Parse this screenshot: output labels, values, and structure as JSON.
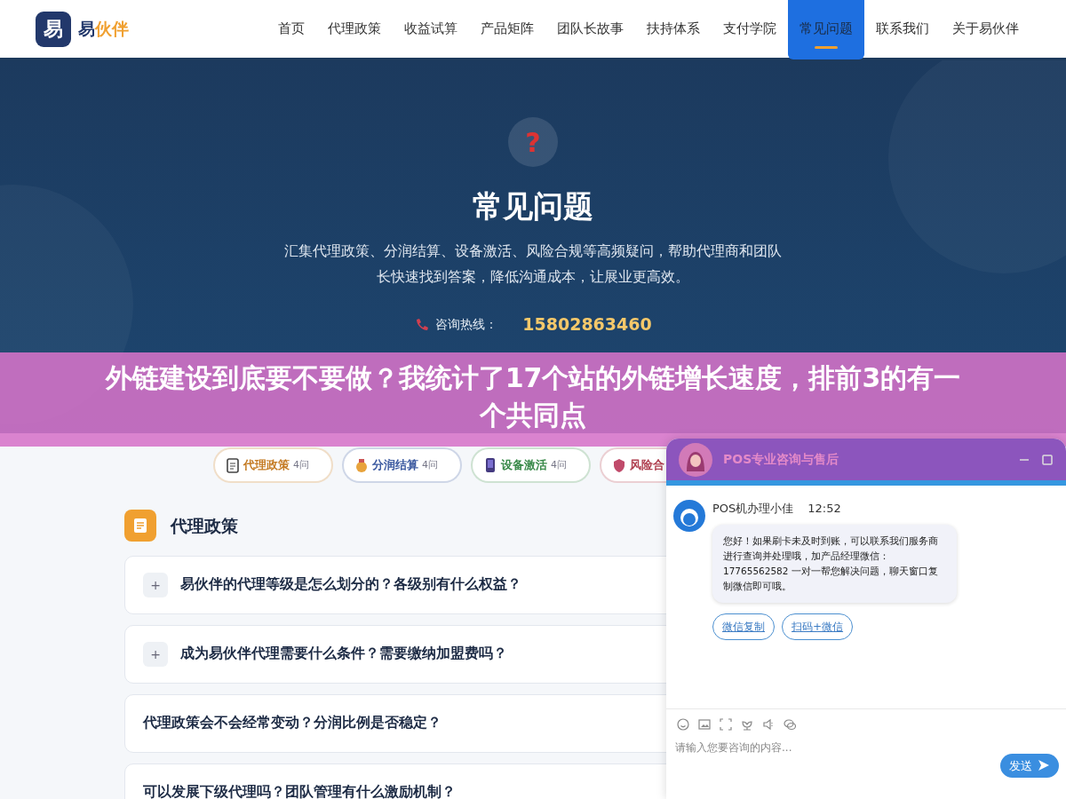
{
  "nav": {
    "logo_mark": "易",
    "brand": "易",
    "brand_accent": "伙伴",
    "items": [
      {
        "label": "首页",
        "selected": false
      },
      {
        "label": "代理政策",
        "selected": false
      },
      {
        "label": "收益试算",
        "selected": false
      },
      {
        "label": "产品矩阵",
        "selected": false
      },
      {
        "label": "团队长故事",
        "selected": false
      },
      {
        "label": "扶持体系",
        "selected": false
      },
      {
        "label": "支付学院",
        "selected": false
      },
      {
        "label": "常见问题",
        "selected": true
      },
      {
        "label": "联系我们",
        "selected": false
      },
      {
        "label": "关于易伙伴",
        "selected": false
      }
    ]
  },
  "hero": {
    "icon": "?",
    "title": "常见问题",
    "description": "汇集代理政策、分润结算、设备激活、风险合规等高频疑问，帮助代理商和团队长快速找到答案，降低沟通成本，让展业更高效。",
    "hotline_label": "咨询热线：",
    "hotline_number": "15802863460"
  },
  "tags": [
    {
      "label": "代理政策",
      "count": "4问",
      "color": "#c47a22"
    },
    {
      "label": "分润结算",
      "count": "4问",
      "color": "#3c5aa0"
    },
    {
      "label": "设备激活",
      "count": "4问",
      "color": "#3a8a4a"
    },
    {
      "label": "风险合",
      "color": "#b04050"
    }
  ],
  "section": {
    "title": "代理政策",
    "faqs": [
      {
        "kind": "expandable",
        "question": "易伙伴的代理等级是怎么划分的？各级别有什么权益？",
        "toggle": "+"
      },
      {
        "kind": "expandable",
        "question": "成为易伙伴代理需要什么条件？需要缴纳加盟费吗？",
        "toggle": "+"
      },
      {
        "kind": "plain",
        "question": "代理政策会不会经常变动？分润比例是否稳定？"
      },
      {
        "kind": "plain",
        "question": "可以发展下级代理吗？团队管理有什么激励机制？"
      }
    ]
  },
  "banner": {
    "text": "外链建设到底要不要做？我统计了17个站的外链增长速度，排前3的有一个共同点"
  },
  "chat": {
    "title": "POS专业咨询与售后",
    "agent": "POS机办理小佳",
    "time": "12:52",
    "message": "您好！如果刷卡未及时到账，可以联系我们服务商进行查询并处理哦，加产品经理微信：17765562582 一对一帮您解决问题，聊天窗口复制微信即可哦。",
    "actions": [
      "微信复制",
      "扫码+微信"
    ],
    "placeholder": "请输入您要咨询的内容...",
    "send": "发送"
  }
}
